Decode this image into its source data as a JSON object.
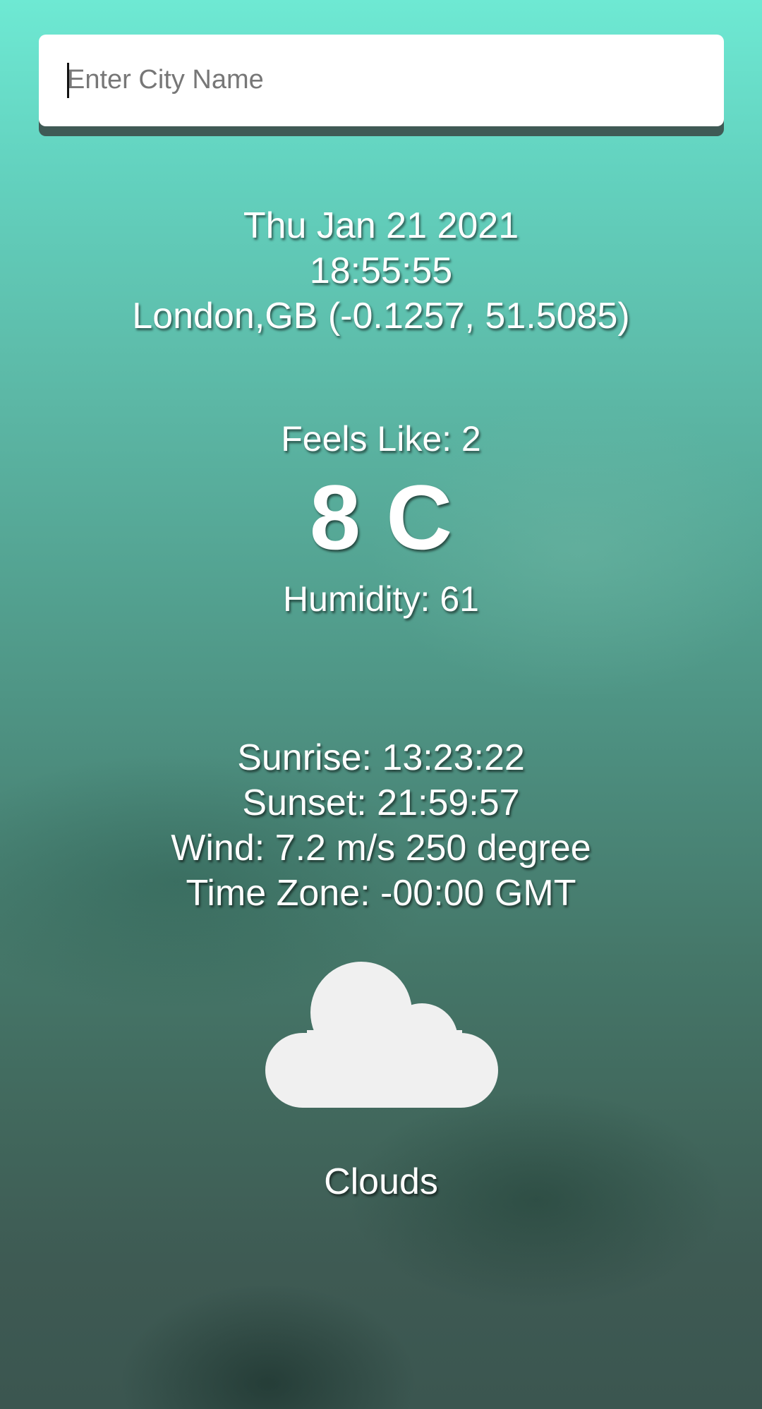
{
  "search": {
    "placeholder": "Enter City Name",
    "value": ""
  },
  "datetime": {
    "date": "Thu Jan 21 2021",
    "time": "18:55:55",
    "location": "London,GB (-0.1257, 51.5085)"
  },
  "weather": {
    "feels_like": "Feels Like: 2",
    "temperature": "8 C",
    "humidity": "Humidity: 61",
    "sunrise": "Sunrise: 13:23:22",
    "sunset": "Sunset: 21:59:57",
    "wind": "Wind: 7.2 m/s 250 degree",
    "time_zone": "Time Zone: -00:00 GMT",
    "condition": "Clouds",
    "icon": "cloud-icon"
  },
  "colors": {
    "background_top": "#6ee9d3",
    "background_bottom": "#3b5650",
    "text": "#ffffff",
    "cloud": "#f0f0f0"
  }
}
